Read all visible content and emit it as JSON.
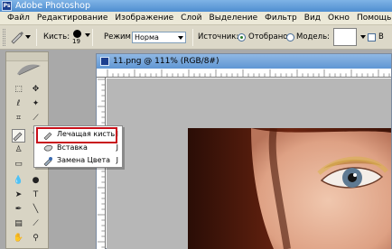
{
  "window": {
    "title": "Adobe Photoshop"
  },
  "menu": [
    "Файл",
    "Редактирование",
    "Изображение",
    "Слой",
    "Выделение",
    "Фильтр",
    "Вид",
    "Окно",
    "Помощь"
  ],
  "options": {
    "brush_label": "Кисть:",
    "brush_size": "19",
    "mode_label": "Режим:",
    "mode_value": "Норма",
    "source_label": "Источник:",
    "sampled_label": "Отобрано",
    "pattern_label": "Модель:",
    "aligned_label": "В"
  },
  "document": {
    "title": "11.png @ 111% (RGB/8#)"
  },
  "flyout": {
    "items": [
      {
        "label": "Лечащая кисть",
        "key": "J",
        "selected": true
      },
      {
        "label": "Вставка",
        "key": "J",
        "selected": false
      },
      {
        "label": "Замена Цвета",
        "key": "J",
        "selected": false
      }
    ]
  },
  "colors": {
    "highlight": "#c8101a",
    "title_bar": "#4f8ed0"
  }
}
